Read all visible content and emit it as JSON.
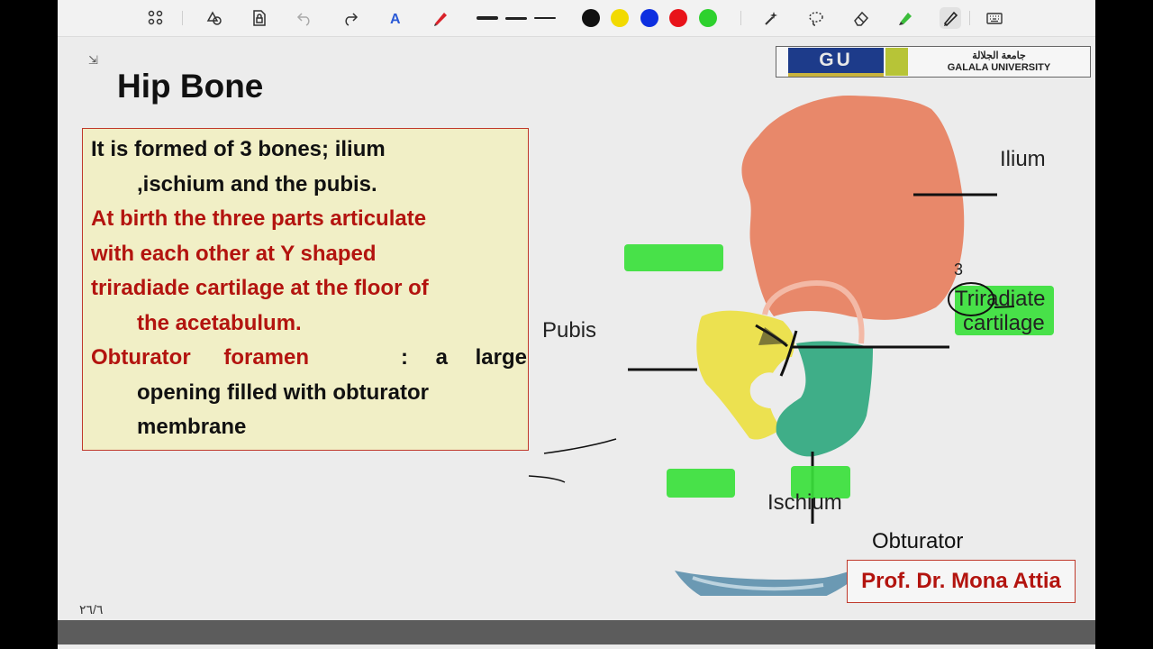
{
  "toolbar": {
    "tools": [
      "grid-icon",
      "shapes-icon",
      "lock-doc-icon",
      "undo-icon",
      "redo-icon",
      "text-a-icon",
      "pen-icon",
      "thick-line",
      "medium-line",
      "thin-line",
      "black-swatch",
      "yellow-swatch",
      "blue-swatch",
      "red-swatch",
      "green-swatch",
      "magic-icon",
      "lasso-icon",
      "eraser-icon",
      "highlighter-icon",
      "pencil-icon",
      "keyboard-icon"
    ],
    "colors": {
      "black": "#111111",
      "yellow": "#f2da00",
      "blue": "#0d2fe0",
      "red": "#e8131a",
      "green": "#2ed12e",
      "pen_red": "#d9222a",
      "highlighter_green": "#3bbd3b"
    }
  },
  "slide": {
    "title": "Hip Bone",
    "logo": {
      "gu": "GU",
      "arabic": "جامعة الجلالة",
      "english": "GALALA UNIVERSITY"
    },
    "paragraphs": [
      {
        "first": "It is formed of 3 bones;  ilium",
        "rest": ",ischium and the pubis.",
        "color": "black"
      },
      {
        "first": "At birth the three parts articulate",
        "rest": "with each other at Y shaped",
        "rest2": "triradiade cartilage at the floor of",
        "rest3": "the acetabulum.",
        "color": "red"
      },
      {
        "term": "Obturator foramen",
        "first": " : a large",
        "rest": "opening filled with obturator",
        "rest2": "membrane"
      }
    ],
    "figure": {
      "labels": {
        "ilium": "Ilium",
        "pubis": "Pubis",
        "triradiate1": "Triradiate",
        "triradiate2": "cartilage",
        "ischium": "Ischium",
        "obturator": "Obturator"
      },
      "annotation_mark": "3",
      "colors": {
        "ilium": "#e8886a",
        "pubis": "#ece150",
        "ischium": "#3fae88",
        "highlight": "#39e03b"
      }
    },
    "author": "Prof. Dr. Mona Attia",
    "page_number": "٢٦/٦"
  }
}
